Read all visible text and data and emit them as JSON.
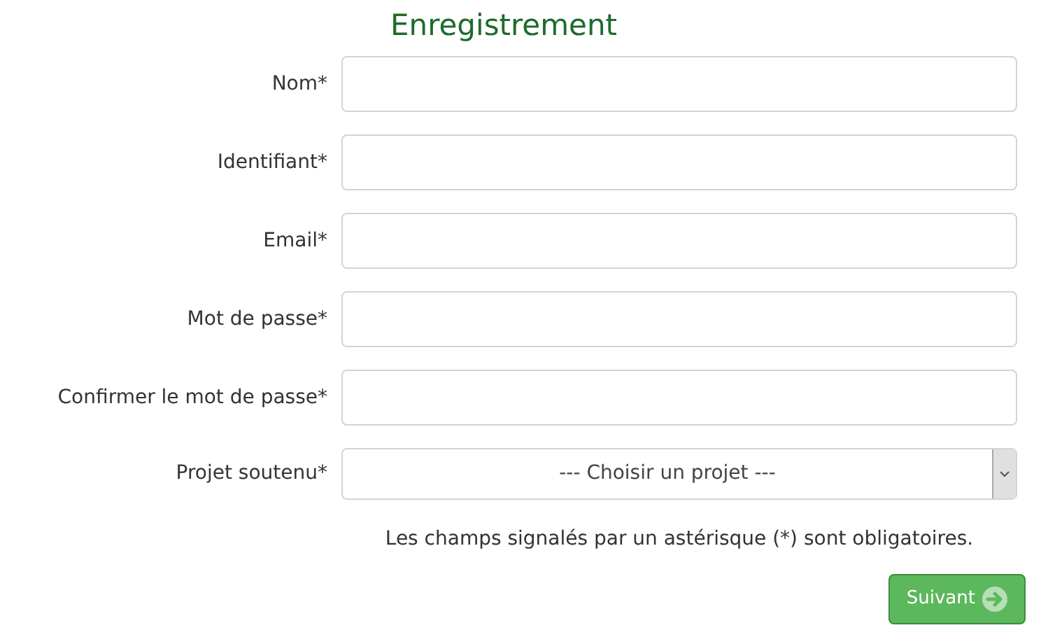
{
  "title": "Enregistrement",
  "fields": [
    {
      "label": "Nom*",
      "kind": "text"
    },
    {
      "label": "Identifiant*",
      "kind": "text"
    },
    {
      "label": "Email*",
      "kind": "text"
    },
    {
      "label": "Mot de passe*",
      "kind": "text"
    },
    {
      "label": "Confirmer le mot de passe*",
      "kind": "text"
    },
    {
      "label": "Projet soutenu*",
      "kind": "select",
      "value": "--- Choisir un projet ---"
    }
  ],
  "note": "Les champs signalés par un astérisque (*) sont obligatoires.",
  "button": {
    "label": "Suivant"
  }
}
